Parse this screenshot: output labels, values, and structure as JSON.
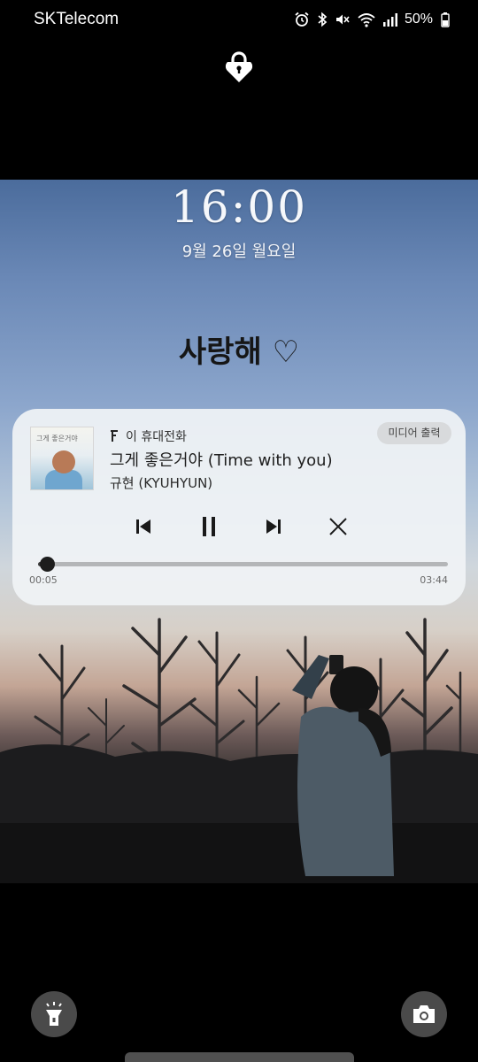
{
  "status_bar": {
    "carrier": "SKTelecom",
    "battery": "50%",
    "icons": [
      "alarm-icon",
      "bluetooth-icon",
      "mute-icon",
      "wifi-icon",
      "signal-icon",
      "battery-icon"
    ]
  },
  "lockscreen": {
    "time": "16:00",
    "date": "9월 26일 월요일",
    "wallpaper_text": "사랑해 ♡"
  },
  "media": {
    "source": "이 휴대전화",
    "output_button": "미디어 출력",
    "title": "그게 좋은거야 (Time with you)",
    "artist": "규현 (KYUHYUN)",
    "elapsed": "00:05",
    "total": "03:44",
    "progress": 0.022,
    "album_art_text": "그게 좋은거야",
    "controls": [
      "previous-icon",
      "pause-icon",
      "next-icon",
      "close-icon"
    ]
  },
  "shortcuts": {
    "left": "flashlight-icon",
    "right": "camera-icon"
  },
  "colors": {
    "card_bg": "#f0f3f5",
    "sky_top": "#4b6c9c",
    "shortcut_bg": "#4a4a4a"
  }
}
